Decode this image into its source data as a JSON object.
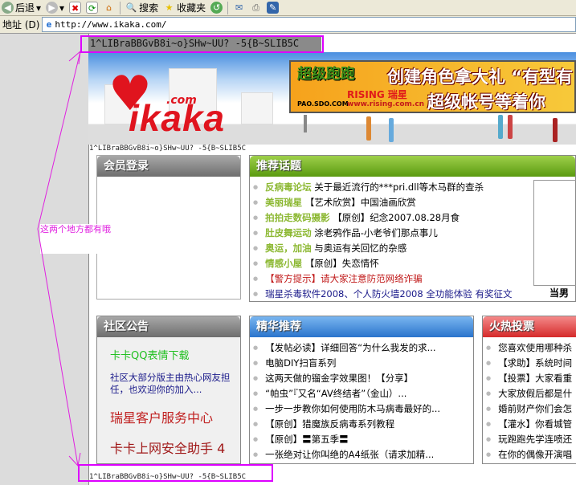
{
  "browser": {
    "back": "后退",
    "search": "搜索",
    "favorites": "收藏夹",
    "address_label": "地址 (D)",
    "url": "http://www.ikaka.com/"
  },
  "garbled_text": "1^LIBraBBGvB8i~o}SHw~UU? -5{B~SLIB5C",
  "banner": {
    "logo": "ikaka",
    "logo_com": ".com",
    "ad_game": "超级跑跑",
    "ad_pao": "PAO.SDO.COM",
    "ad_rising": "RISING 瑞星",
    "ad_url": "www.rising.com.cn",
    "ad_line1": "创建角色拿大礼 “有型有",
    "ad_line2": "超级帐号等着你"
  },
  "login": {
    "title": "会员登录"
  },
  "topics": {
    "title": "推荐话题",
    "items": [
      {
        "k": "反病毒论坛",
        "t": "关于最近流行的***pri.dll等木马群的查杀"
      },
      {
        "k": "美丽瑞星",
        "t": "【艺术欣赏】中国油画欣赏"
      },
      {
        "k": "拍拍走数码摄影",
        "t": "【原创】纪念2007.08.28月食"
      },
      {
        "k": "肚皮舞运动",
        "t": "涂老鸦作品-小老爷们那点事儿"
      },
      {
        "k": "奥运，加油",
        "t": "与奥运有关回忆的杂感"
      },
      {
        "k": "情感小屋",
        "t": "【原创】失恋情怀"
      },
      {
        "k": "",
        "t": "【警方提示】请大家注意防范网络诈骗"
      },
      {
        "k": "",
        "t": "瑞星杀毒软件2008、个人防火墙2008 全功能体验 有奖征文"
      }
    ],
    "image_caption": "当男"
  },
  "notice": {
    "title": "社区公告",
    "items": [
      "卡卡QQ表情下载",
      "社区大部分版主由热心网友担任，也欢迎你的加入...",
      "瑞星客户服务中心",
      "卡卡上网安全助手 4"
    ]
  },
  "featured": {
    "title": "精华推荐",
    "items": [
      "【发帖必读】详细回答“为什么我发的求...",
      "电脑DIY扫盲系列",
      "这两天做的镏金字效果图！【分享】",
      "“帕虫”『又名“AV终结者”（金山）...",
      "一步一步教你如何使用防木马病毒最好的...",
      "【原创】猎魔族反病毒系列教程",
      "【原创】〓第五季〓",
      "一张绝对让你叫绝的A4纸张（请求加精..."
    ]
  },
  "votes": {
    "title": "火热投票",
    "items": [
      "您喜欢使用哪种杀",
      "【求助】系统时间",
      "【投票】大家看重",
      "大家放假后都是什",
      "婚前财产你们会怎",
      "【灌水】你看城管",
      "玩跑跑先学连喷还",
      "在你的偶像开演唱"
    ]
  },
  "annotation": "这两个地方都有哦"
}
